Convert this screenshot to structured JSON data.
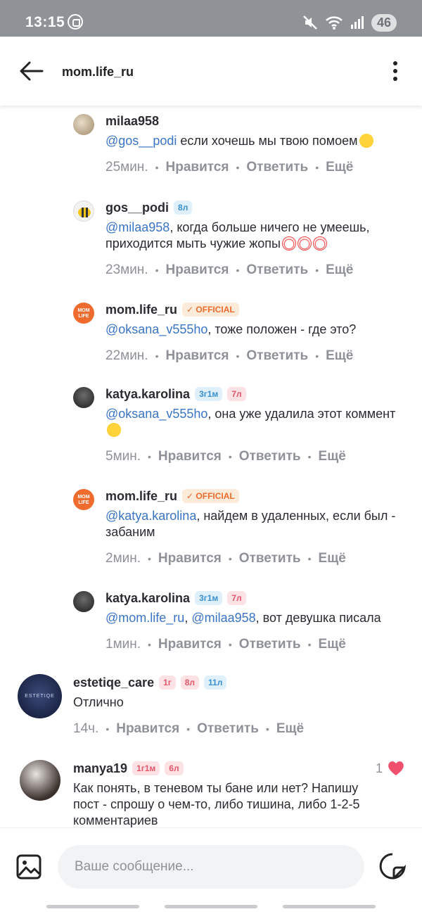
{
  "status_bar": {
    "time": "13:15",
    "battery": "46"
  },
  "header": {
    "title": "mom.life_ru"
  },
  "comments": [
    {
      "username": "milaa958",
      "badges": [],
      "mention": "@gos__podi",
      "text": " если хочешь мы твою помоем",
      "time": "25мин.",
      "like": "Нравится",
      "reply": "Ответить",
      "more": "Ещё"
    },
    {
      "username": "gos__podi",
      "badges": [
        "8л"
      ],
      "mention": "@milaa958",
      "text": ", когда больше ничего не умеешь, приходится мыть чужие жопы",
      "time": "23мин.",
      "like": "Нравится",
      "reply": "Ответить",
      "more": "Ещё"
    },
    {
      "username": "mom.life_ru",
      "badges": [
        "OFFICIAL"
      ],
      "mention": "@oksana_v555ho",
      "text": ", тоже положен - где это?",
      "time": "22мин.",
      "like": "Нравится",
      "reply": "Ответить",
      "more": "Ещё"
    },
    {
      "username": "katya.karolina",
      "badges": [
        "3г1м",
        "7л"
      ],
      "mention": "@oksana_v555ho",
      "text": ", она уже удалила этот коммент",
      "time": "5мин.",
      "like": "Нравится",
      "reply": "Ответить",
      "more": "Ещё"
    },
    {
      "username": "mom.life_ru",
      "badges": [
        "OFFICIAL"
      ],
      "mention": "@katya.karolina",
      "text": ", найдем в удаленных, если был - забаним",
      "time": "2мин.",
      "like": "Нравится",
      "reply": "Ответить",
      "more": "Ещё"
    },
    {
      "username": "katya.karolina",
      "badges": [
        "3г1м",
        "7л"
      ],
      "mention": "@mom.life_ru",
      "mention2": "@milaa958",
      "text": ",  вот девушка писала",
      "time": "1мин.",
      "like": "Нравится",
      "reply": "Ответить",
      "more": "Ещё"
    },
    {
      "username": "estetiqe_care",
      "badges": [
        "1г",
        "8л",
        "11л"
      ],
      "text": "Отлично",
      "time": "14ч.",
      "like": "Нравится",
      "reply": "Ответить",
      "more": "Ещё"
    },
    {
      "username": "manya19",
      "badges": [
        "1г1м",
        "6л"
      ],
      "text": "Как понять, в теневом ты бане или нет? Напишу пост - спрошу о чем-то, либо тишина, либо 1-2-5 комментариев",
      "like_count": "1"
    }
  ],
  "avatars": {
    "mom_life_logo": "MOM LIFE",
    "estetiqe_logo": "ESTETIQE CARE"
  },
  "composer": {
    "placeholder": "Ваше сообщение..."
  },
  "colors": {
    "accent_orange": "#f06b2e",
    "mention_blue": "#3a74c6",
    "heart": "#f0506e"
  }
}
